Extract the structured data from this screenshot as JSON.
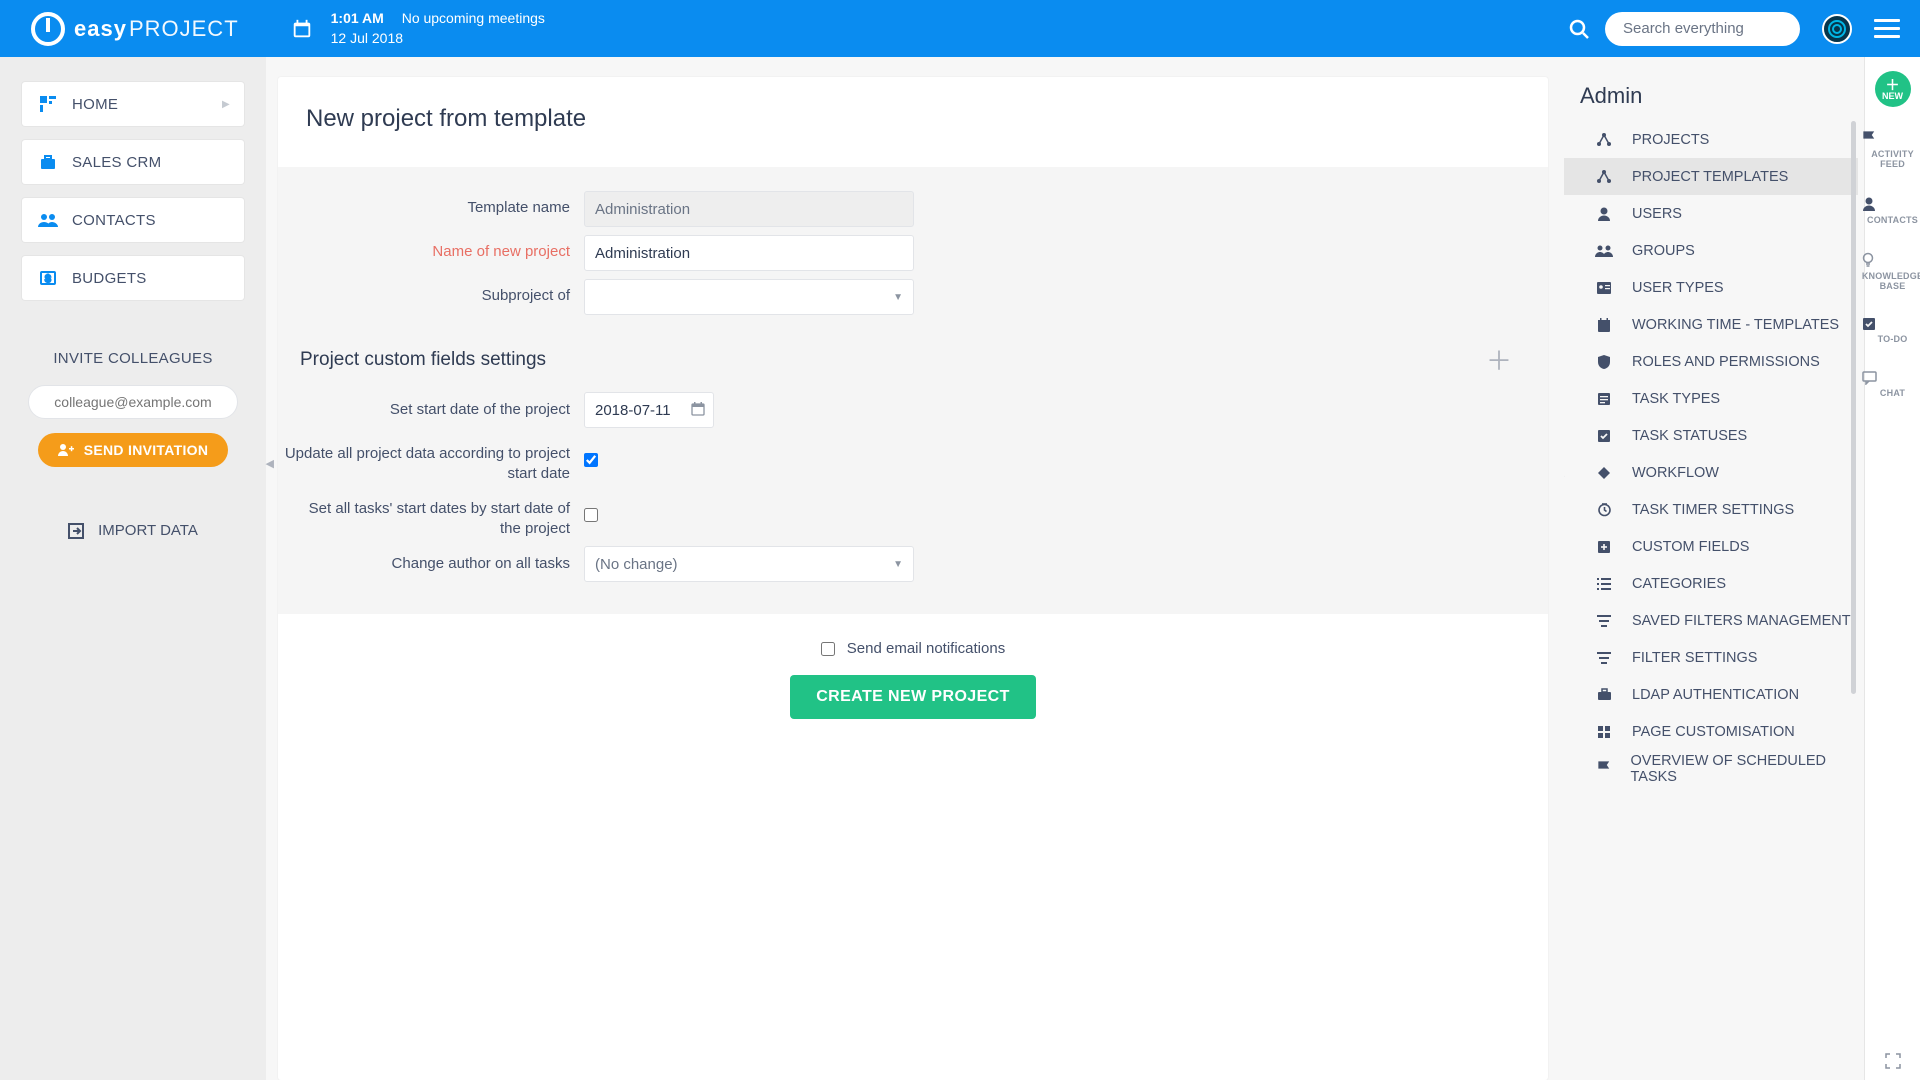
{
  "brand": {
    "bold": "easy",
    "light": "PROJECT"
  },
  "header": {
    "time": "1:01 AM",
    "meetings": "No upcoming meetings",
    "date": "12 Jul 2018",
    "search_placeholder": "Search everything"
  },
  "left": {
    "items": [
      {
        "label": "HOME"
      },
      {
        "label": "SALES CRM"
      },
      {
        "label": "CONTACTS"
      },
      {
        "label": "BUDGETS"
      }
    ],
    "invite_title": "INVITE COLLEAGUES",
    "invite_placeholder": "colleague@example.com",
    "invite_button": "SEND INVITATION",
    "import": "IMPORT DATA"
  },
  "page": {
    "title": "New project from template",
    "fields": {
      "template_name_label": "Template name",
      "template_name_value": "Administration",
      "new_name_label": "Name of new project",
      "new_name_value": "Administration",
      "subproject_label": "Subproject of",
      "subproject_value": ""
    },
    "subheader": "Project custom fields settings",
    "custom": {
      "start_date_label": "Set start date of the project",
      "start_date_value": "2018-07-11",
      "update_label": "Update all project data according to project start date",
      "update_checked": true,
      "set_tasks_label": "Set all tasks' start dates by start date of the project",
      "set_tasks_checked": false,
      "author_label": "Change author on all tasks",
      "author_value": "(No change)"
    },
    "footer": {
      "notif_label": "Send email notifications",
      "notif_checked": false,
      "submit": "CREATE NEW PROJECT"
    }
  },
  "admin": {
    "title": "Admin",
    "active_index": 1,
    "items": [
      {
        "label": "PROJECTS",
        "icon": "share-icon"
      },
      {
        "label": "PROJECT TEMPLATES",
        "icon": "share-icon"
      },
      {
        "label": "USERS",
        "icon": "user-icon"
      },
      {
        "label": "GROUPS",
        "icon": "group-icon"
      },
      {
        "label": "USER TYPES",
        "icon": "id-icon"
      },
      {
        "label": "WORKING TIME - TEMPLATES",
        "icon": "calendar-icon"
      },
      {
        "label": "ROLES AND PERMISSIONS",
        "icon": "shield-icon"
      },
      {
        "label": "TASK TYPES",
        "icon": "list-icon"
      },
      {
        "label": "TASK STATUSES",
        "icon": "check-icon"
      },
      {
        "label": "WORKFLOW",
        "icon": "workflow-icon"
      },
      {
        "label": "TASK TIMER SETTINGS",
        "icon": "clock-icon"
      },
      {
        "label": "CUSTOM FIELDS",
        "icon": "plus-box-icon"
      },
      {
        "label": "CATEGORIES",
        "icon": "list2-icon"
      },
      {
        "label": "SAVED FILTERS MANAGEMENT",
        "icon": "filter-icon"
      },
      {
        "label": "FILTER SETTINGS",
        "icon": "filter-icon"
      },
      {
        "label": "LDAP AUTHENTICATION",
        "icon": "case-icon"
      },
      {
        "label": "PAGE CUSTOMISATION",
        "icon": "grid-icon"
      },
      {
        "label": "OVERVIEW OF SCHEDULED TASKS",
        "icon": "flag-icon"
      }
    ]
  },
  "rail": {
    "new": "NEW",
    "items": [
      {
        "label": "ACTIVITY FEED",
        "name": "activity-feed",
        "icon": "flag-icon"
      },
      {
        "label": "CONTACTS",
        "name": "contacts",
        "icon": "user-icon"
      },
      {
        "label": "KNOWLEDGE BASE",
        "name": "knowledge-base",
        "icon": "bulb-icon"
      },
      {
        "label": "TO-DO",
        "name": "todo",
        "icon": "check-icon"
      },
      {
        "label": "CHAT",
        "name": "chat",
        "icon": "chat-icon"
      }
    ]
  }
}
